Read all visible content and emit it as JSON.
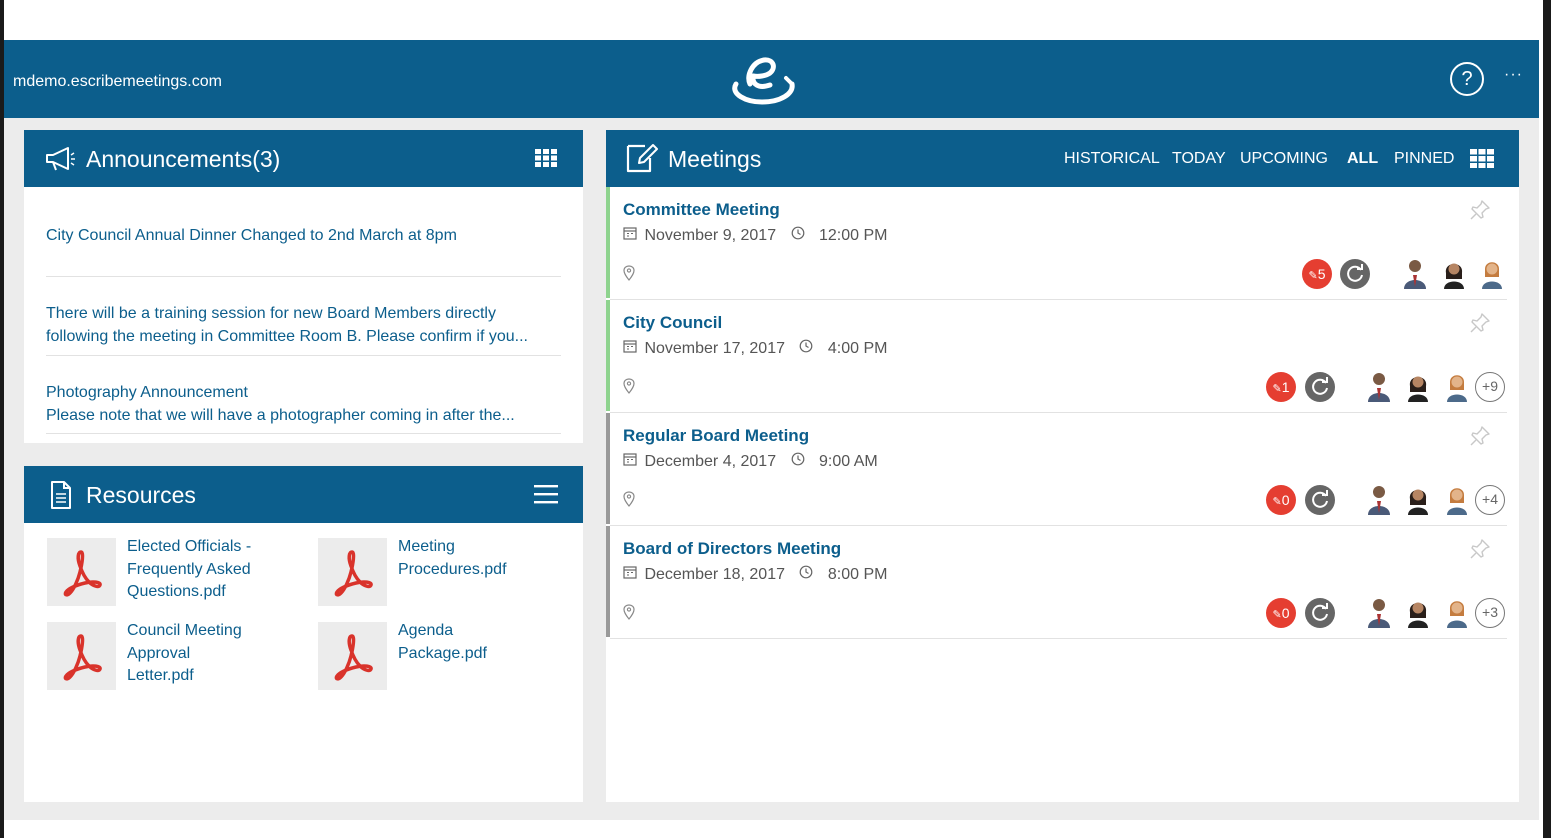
{
  "header": {
    "domain": "mdemo.escribemeetings.com",
    "help_label": "?",
    "more_label": "···"
  },
  "announcements": {
    "title": "Announcements(3)",
    "items": [
      {
        "text": "City Council Annual Dinner Changed to 2nd March at 8pm"
      },
      {
        "text": "There will be a training session for new Board Members directly following the meeting in Committee Room B. Please confirm if you..."
      },
      {
        "title": "Photography Announcement",
        "text": "Please note that we will have a photographer coming in after the..."
      }
    ]
  },
  "resources": {
    "title": "Resources",
    "items": [
      {
        "name": "Elected Officials - Frequently Asked Questions.pdf"
      },
      {
        "name": "Meeting Procedures.pdf"
      },
      {
        "name": "Council Meeting Approval Letter.pdf"
      },
      {
        "name": "Agenda Package.pdf"
      }
    ]
  },
  "meetings": {
    "title": "Meetings",
    "tabs": [
      "HISTORICAL",
      "TODAY",
      "UPCOMING",
      "ALL",
      "PINNED"
    ],
    "active_tab": "ALL",
    "items": [
      {
        "title": "Committee Meeting",
        "date": "November 9, 2017",
        "time": "12:00 PM",
        "count": "5",
        "extra": "",
        "bar_color": "#8ed38e"
      },
      {
        "title": "City Council",
        "date": "November 17, 2017",
        "time": "4:00 PM",
        "count": "1",
        "extra": "+9",
        "bar_color": "#8ed38e"
      },
      {
        "title": "Regular Board Meeting",
        "date": "December 4, 2017",
        "time": "9:00 AM",
        "count": "0",
        "extra": "+4",
        "bar_color": "#999999"
      },
      {
        "title": "Board of Directors Meeting",
        "date": "December 18, 2017",
        "time": "8:00 PM",
        "count": "0",
        "extra": "+3",
        "bar_color": "#999999"
      }
    ]
  },
  "colors": {
    "brand": "#0c5e8c",
    "badge_red": "#e53e31",
    "badge_gray": "#666666",
    "pdf_red": "#d9332b"
  }
}
